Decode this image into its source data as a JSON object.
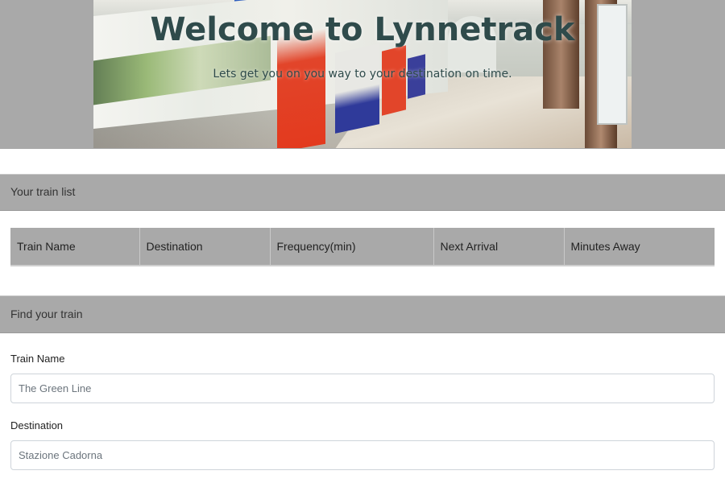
{
  "header": {
    "title": "Welcome to Lynnetrack",
    "subtitle": "Lets get you on you way to your destination on time.",
    "background_color": "#a9a9a9",
    "title_color": "#2f4b4b"
  },
  "train_list": {
    "heading": "Your train list",
    "columns": [
      "Train Name",
      "Destination",
      "Frequency(min)",
      "Next Arrival",
      "Minutes Away"
    ]
  },
  "find_train": {
    "heading": "Find your train",
    "train_name_label": "Train Name",
    "train_name_placeholder": "The Green Line",
    "destination_label": "Destination",
    "destination_placeholder": "Stazione Cadorna"
  }
}
